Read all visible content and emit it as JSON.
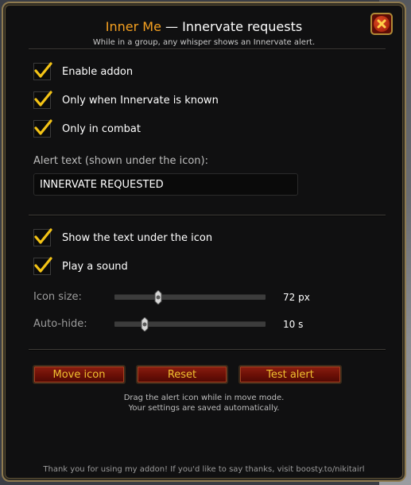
{
  "header": {
    "addon_name": "Inner Me",
    "separator": " — ",
    "title": "Innervate requests",
    "subtitle": "While in a group, any whisper shows an Innervate alert."
  },
  "options": {
    "enable_addon": {
      "label": "Enable addon",
      "checked": true
    },
    "only_when_known": {
      "label": "Only when Innervate is known",
      "checked": true
    },
    "only_in_combat": {
      "label": "Only in combat",
      "checked": true
    },
    "alert_text_label": "Alert text (shown under the icon):",
    "alert_text_value": "INNERVATE REQUESTED",
    "show_text": {
      "label": "Show the text under the icon",
      "checked": true
    },
    "play_sound": {
      "label": "Play a sound",
      "checked": true
    }
  },
  "sliders": {
    "icon_size": {
      "label": "Icon size:",
      "value": "72 px",
      "fraction": 0.29
    },
    "auto_hide": {
      "label": "Auto-hide:",
      "value": "10 s",
      "fraction": 0.2
    }
  },
  "buttons": {
    "move_icon": "Move icon",
    "reset": "Reset",
    "test_alert": "Test alert"
  },
  "hints": {
    "line1": "Drag the alert icon while in move mode.",
    "line2": "Your settings are saved automatically."
  },
  "footer": "Thank you for using my addon! If you'd like to say thanks, visit boosty.to/nikitairl",
  "colors": {
    "accent_gold": "#f5a020",
    "check_yellow": "#f3c316",
    "button_red": "#7a1409",
    "button_text": "#f0c030"
  },
  "icons": {
    "close": "close-x-icon",
    "check": "checkmark-icon",
    "slider": "slider-thumb-icon"
  }
}
